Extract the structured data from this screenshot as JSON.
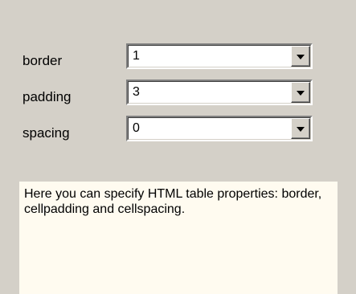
{
  "form": {
    "rows": [
      {
        "label": "border",
        "value": "1"
      },
      {
        "label": "padding",
        "value": "3"
      },
      {
        "label": "spacing",
        "value": "0"
      }
    ],
    "dropdown_icon": "chevron-down-icon"
  },
  "description": {
    "text": "Here you can specify HTML  table properties: border, cellpadding and cellspacing."
  },
  "colors": {
    "panel_bg": "#d4d0c8",
    "info_bg": "#fffbf0"
  }
}
